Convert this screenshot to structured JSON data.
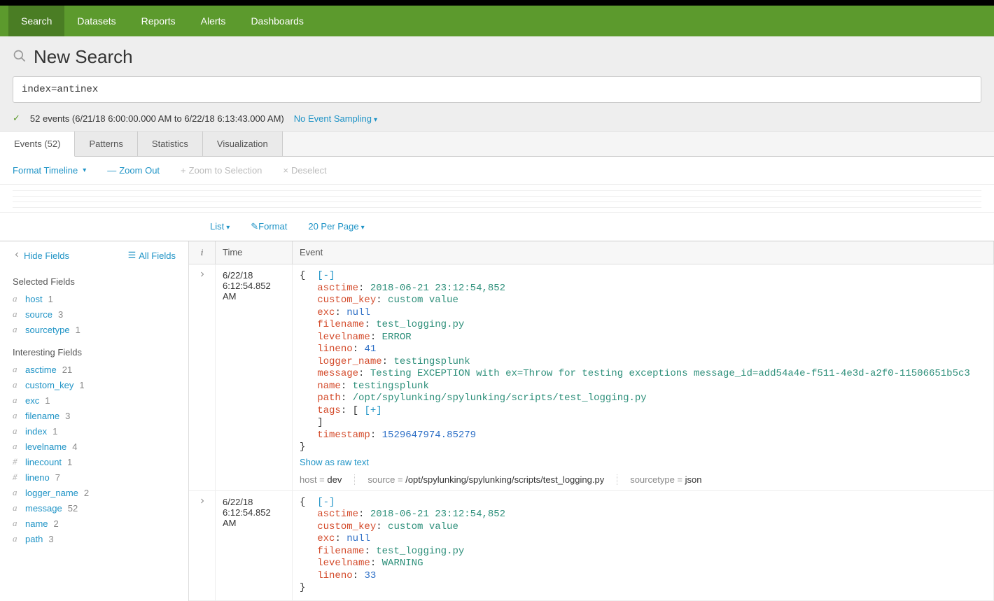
{
  "nav": {
    "items": [
      "Search",
      "Datasets",
      "Reports",
      "Alerts",
      "Dashboards"
    ],
    "active": 0
  },
  "page": {
    "title": "New Search",
    "search_query": "index=antinex"
  },
  "status": {
    "text": "52 events (6/21/18 6:00:00.000 AM to 6/22/18 6:13:43.000 AM)",
    "sampling": "No Event Sampling"
  },
  "result_tabs": {
    "items": [
      "Events (52)",
      "Patterns",
      "Statistics",
      "Visualization"
    ],
    "active": 0
  },
  "timeline_ctrl": {
    "format": "Format Timeline",
    "zoom_out": "Zoom Out",
    "zoom_sel": "Zoom to Selection",
    "deselect": "Deselect"
  },
  "view_ctrl": {
    "list": "List",
    "format": "Format",
    "per_page": "20 Per Page"
  },
  "sidebar": {
    "hide": "Hide Fields",
    "all": "All Fields",
    "selected_title": "Selected Fields",
    "interesting_title": "Interesting Fields",
    "selected": [
      {
        "t": "a",
        "name": "host",
        "c": "1"
      },
      {
        "t": "a",
        "name": "source",
        "c": "3"
      },
      {
        "t": "a",
        "name": "sourcetype",
        "c": "1"
      }
    ],
    "interesting": [
      {
        "t": "a",
        "name": "asctime",
        "c": "21"
      },
      {
        "t": "a",
        "name": "custom_key",
        "c": "1"
      },
      {
        "t": "a",
        "name": "exc",
        "c": "1"
      },
      {
        "t": "a",
        "name": "filename",
        "c": "3"
      },
      {
        "t": "a",
        "name": "index",
        "c": "1"
      },
      {
        "t": "a",
        "name": "levelname",
        "c": "4"
      },
      {
        "t": "#",
        "name": "linecount",
        "c": "1"
      },
      {
        "t": "#",
        "name": "lineno",
        "c": "7"
      },
      {
        "t": "a",
        "name": "logger_name",
        "c": "2"
      },
      {
        "t": "a",
        "name": "message",
        "c": "52"
      },
      {
        "t": "a",
        "name": "name",
        "c": "2"
      },
      {
        "t": "a",
        "name": "path",
        "c": "3"
      }
    ]
  },
  "table": {
    "col_i": "i",
    "col_time": "Time",
    "col_event": "Event",
    "raw_text": "Show as raw text"
  },
  "events": [
    {
      "date": "6/22/18",
      "time": "6:12:54.852 AM",
      "fields": [
        {
          "k": "asctime",
          "v": "2018-06-21 23:12:54,852",
          "vt": "str"
        },
        {
          "k": "custom_key",
          "v": "custom value",
          "vt": "str"
        },
        {
          "k": "exc",
          "v": "null",
          "vt": "null"
        },
        {
          "k": "filename",
          "v": "test_logging.py",
          "vt": "str"
        },
        {
          "k": "levelname",
          "v": "ERROR",
          "vt": "str"
        },
        {
          "k": "lineno",
          "v": "41",
          "vt": "num"
        },
        {
          "k": "logger_name",
          "v": "testingsplunk",
          "vt": "str"
        },
        {
          "k": "message",
          "v": "Testing EXCEPTION with ex=Throw for testing exceptions message_id=add54a4e-f511-4e3d-a2f0-11506651b5c3",
          "vt": "str"
        },
        {
          "k": "name",
          "v": "testingsplunk",
          "vt": "str"
        },
        {
          "k": "path",
          "v": "/opt/spylunking/spylunking/scripts/test_logging.py",
          "vt": "str"
        },
        {
          "k": "tags",
          "v": "[+]",
          "vt": "arr"
        },
        {
          "k": "timestamp",
          "v": "1529647974.85279",
          "vt": "num"
        }
      ],
      "meta": {
        "host": "dev",
        "source": "/opt/spylunking/spylunking/scripts/test_logging.py",
        "sourcetype": "json"
      }
    },
    {
      "date": "6/22/18",
      "time": "6:12:54.852 AM",
      "fields": [
        {
          "k": "asctime",
          "v": "2018-06-21 23:12:54,852",
          "vt": "str"
        },
        {
          "k": "custom_key",
          "v": "custom value",
          "vt": "str"
        },
        {
          "k": "exc",
          "v": "null",
          "vt": "null"
        },
        {
          "k": "filename",
          "v": "test_logging.py",
          "vt": "str"
        },
        {
          "k": "levelname",
          "v": "WARNING",
          "vt": "str"
        },
        {
          "k": "lineno",
          "v": "33",
          "vt": "num"
        }
      ],
      "meta": null
    }
  ]
}
